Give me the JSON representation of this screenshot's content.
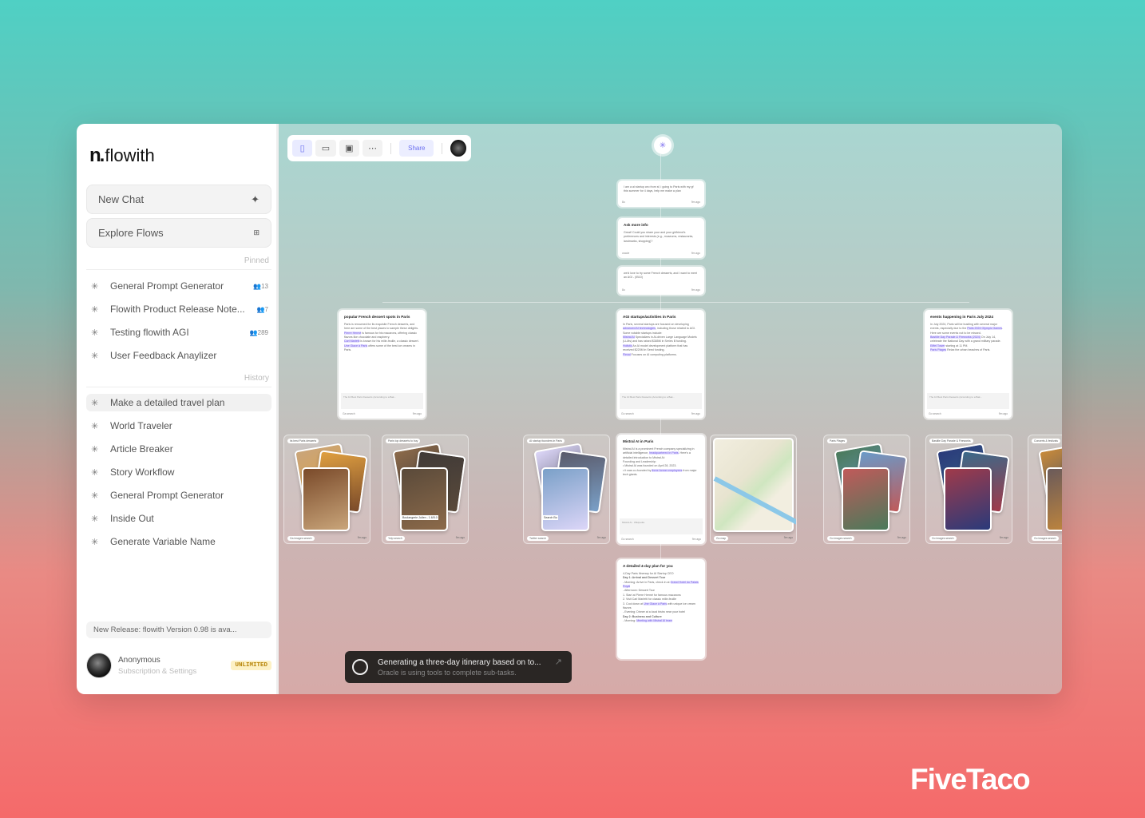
{
  "app": {
    "name": "flowith"
  },
  "sidebar": {
    "new_chat": "New Chat",
    "explore": "Explore Flows",
    "pinned_label": "Pinned",
    "history_label": "History",
    "pinned": [
      {
        "label": "General Prompt Generator",
        "count": "13"
      },
      {
        "label": "Flowith Product Release Note...",
        "count": "7"
      },
      {
        "label": "Testing flowith AGI",
        "count": "289"
      },
      {
        "label": "User Feedback Anaylizer",
        "count": ""
      }
    ],
    "history": [
      {
        "label": "Make a detailed travel plan"
      },
      {
        "label": "World Traveler"
      },
      {
        "label": "Article Breaker"
      },
      {
        "label": "Story Workflow"
      },
      {
        "label": "General Prompt Generator"
      },
      {
        "label": "Inside Out"
      },
      {
        "label": "Generate Variable Name"
      }
    ],
    "release": "New Release: flowith Version 0.98 is ava...",
    "user": {
      "name": "Anonymous",
      "sub": "Subscription & Settings",
      "badge": "UNLIMITED"
    }
  },
  "toolbar": {
    "share": "Share",
    "icons": [
      "sidebar-icon",
      "comment-icon",
      "present-icon",
      "more-icon"
    ]
  },
  "nodes": {
    "q1": {
      "text": "I am a ai startup ceo from sf, i going to Paris with my gf this summer for 4 days, help me make a plan",
      "user": "8o",
      "time": "9m ago"
    },
    "q2": {
      "title": "Ask more info",
      "text": "Great! Could you share your and your girlfriend's preferences and interests (e.g., museums, restaurants, landmarks, shopping)?",
      "user": "oracle",
      "time": "9m ago"
    },
    "q3": {
      "text": "we'd love to try some French desserts, and I want to meet an AGI - (IB10)",
      "user": "8o",
      "time": "9m ago"
    },
    "dessert": {
      "title": "popular French dessert spots in Paris",
      "text": "Paris is renowned for its exquisite French desserts, and here are some of the best places to sample these delights.",
      "b1": "Pierre Hermé",
      "b1t": " is famous for his macarons, offering classic flavors like chocolate and raspberry.",
      "b2": "Carl Marletti",
      "b2t": " is known for his mille-feuille, a classic dessert.",
      "b3": "Une Glace à Paris",
      "b3t": " offers some of the best ice creams in Paris.",
      "src": "The 10 Best Paris Desserts (According to a Bak...",
      "tool": "Ga search",
      "time": "9m ago"
    },
    "agi": {
      "title": "AGI startups/activities in Paris",
      "text": "In Paris, several startups are focused on developing ",
      "hl": "advanced AI technologies",
      "text2": ", including those related to AGI. Some notable startups include:",
      "b1": "Mistral AI",
      "b1t": " Specializes in AI-driven Large Language Models (LLMs) and has raised $385M in Series B funding.",
      "b2": "Holistic",
      "b2t": " An AI model development platform that has received $220M in Seed funding.",
      "b3": "Flexai",
      "b3t": " Focuses on AI computing platforms.",
      "src": "The 10 Best Paris Desserts (According to a Bak...",
      "tool": "Go search",
      "time": "9m ago"
    },
    "events": {
      "title": "events happening in Paris July 2024",
      "text": "In July 2024, Paris will be bustling with several major events, especially due to the ",
      "hl": "Paris 2024 Olympic Games",
      "text2": ". Here are some events not to be missed.",
      "b1": "Bastille Day Parade & Fireworks (2024)",
      "b1t": " On July 14, celebrate the National Day with a grand military parade.",
      "b2": "Eiffel Tower",
      "b2t": " starting at 11 PM.",
      "b3": "Paris Plages",
      "b3t": " Relax the urban beaches of Paris.",
      "src": "The 10 Best Paris Desserts (According to a Bak...",
      "tool": "Go search",
      "time": "9m ago"
    },
    "mistral": {
      "title": "Mistral AI in Paris",
      "text": "Mistral AI is a prominent French company specializing in artificial intelligence, ",
      "hl": "headquartered in Paris",
      "text2": ". Here's a detailed introduction to Mistral AI:",
      "sub": "Founding and Leadership:",
      "b1": "Mistral AI was founded on April 28, 2023.",
      "b2": "It was co-founded by ",
      "b2h": "three former employees",
      "b2t": " from major tech giants.",
      "src": "Mistral AI - Wikipedia",
      "tool": "Go search",
      "time": "9m ago"
    },
    "plan": {
      "title": "A detailed 4-day plan for you",
      "text": "4-Day Paris Itinerary for AI Startup CEO",
      "d1": "Day 1: Arrival and Dessert Tour",
      "m1": "- Morning: Arrive in Paris, check in at ",
      "m1h": "Grand Hotel du Palais Royal",
      "a1": "- Afternoon: Dessert Tour",
      "s1": "1. Start at Pierre Hermé for famous macarons",
      "s2": "2. Visit Carl Marletti for classic mille-feuille",
      "s3": "3. Cool down at ",
      "s3h": "Une Glace à Paris",
      "s3t": " with unique ice cream flavors",
      "e1": "- Evening: Dinner at a local bistro near your hotel",
      "d2": "Day 2: Business and Culture",
      "m2": "- Morning: ",
      "m2h": "Meeting with Mistral AI team"
    }
  },
  "cards": [
    {
      "tag": "its best Paris desserts",
      "tool": "Ga images search",
      "time": "9m ago",
      "colors": [
        "#c9a57a",
        "#e0a040",
        "#7a4a2a"
      ]
    },
    {
      "tag": "Paris top desserts to buy",
      "tool": "Yelp search",
      "time": "9m ago",
      "colors": [
        "#8c6a4a",
        "#403a38",
        "#5a4a3a"
      ],
      "caption": "Boulangerie Julien - 1.6/5.0"
    },
    {
      "tag": "AI startup founders in Paris",
      "tool": "Twitter search",
      "time": "9m ago",
      "colors": [
        "#dcd6f8",
        "#5a5a6a",
        "#7aa0c8"
      ],
      "caption": "Search Bo"
    },
    {
      "tag": "",
      "tool": "Go map",
      "time": "9m ago",
      "map": true
    },
    {
      "tag": "Paris Plages",
      "tool": "Go images search",
      "time": "9m ago",
      "colors": [
        "#4a7a5a",
        "#6a9ac8",
        "#c05a5a"
      ]
    },
    {
      "tag": "Bastille Day Parade & Fireworks",
      "tool": "Go images search",
      "time": "9m ago",
      "colors": [
        "#2a3a7a",
        "#3a6a8a",
        "#a03a4a"
      ]
    },
    {
      "tag": "Concerts & festivals",
      "tool": "Go images search",
      "time": "9m ago",
      "colors": [
        "#c88a3a",
        "#3a4a6a",
        "#6a5a5a"
      ]
    }
  ],
  "status": {
    "title": "Generating a three-day itinerary based on to...",
    "sub": "Oracle is using tools to complete sub-tasks."
  },
  "watermark": "FiveTaco"
}
